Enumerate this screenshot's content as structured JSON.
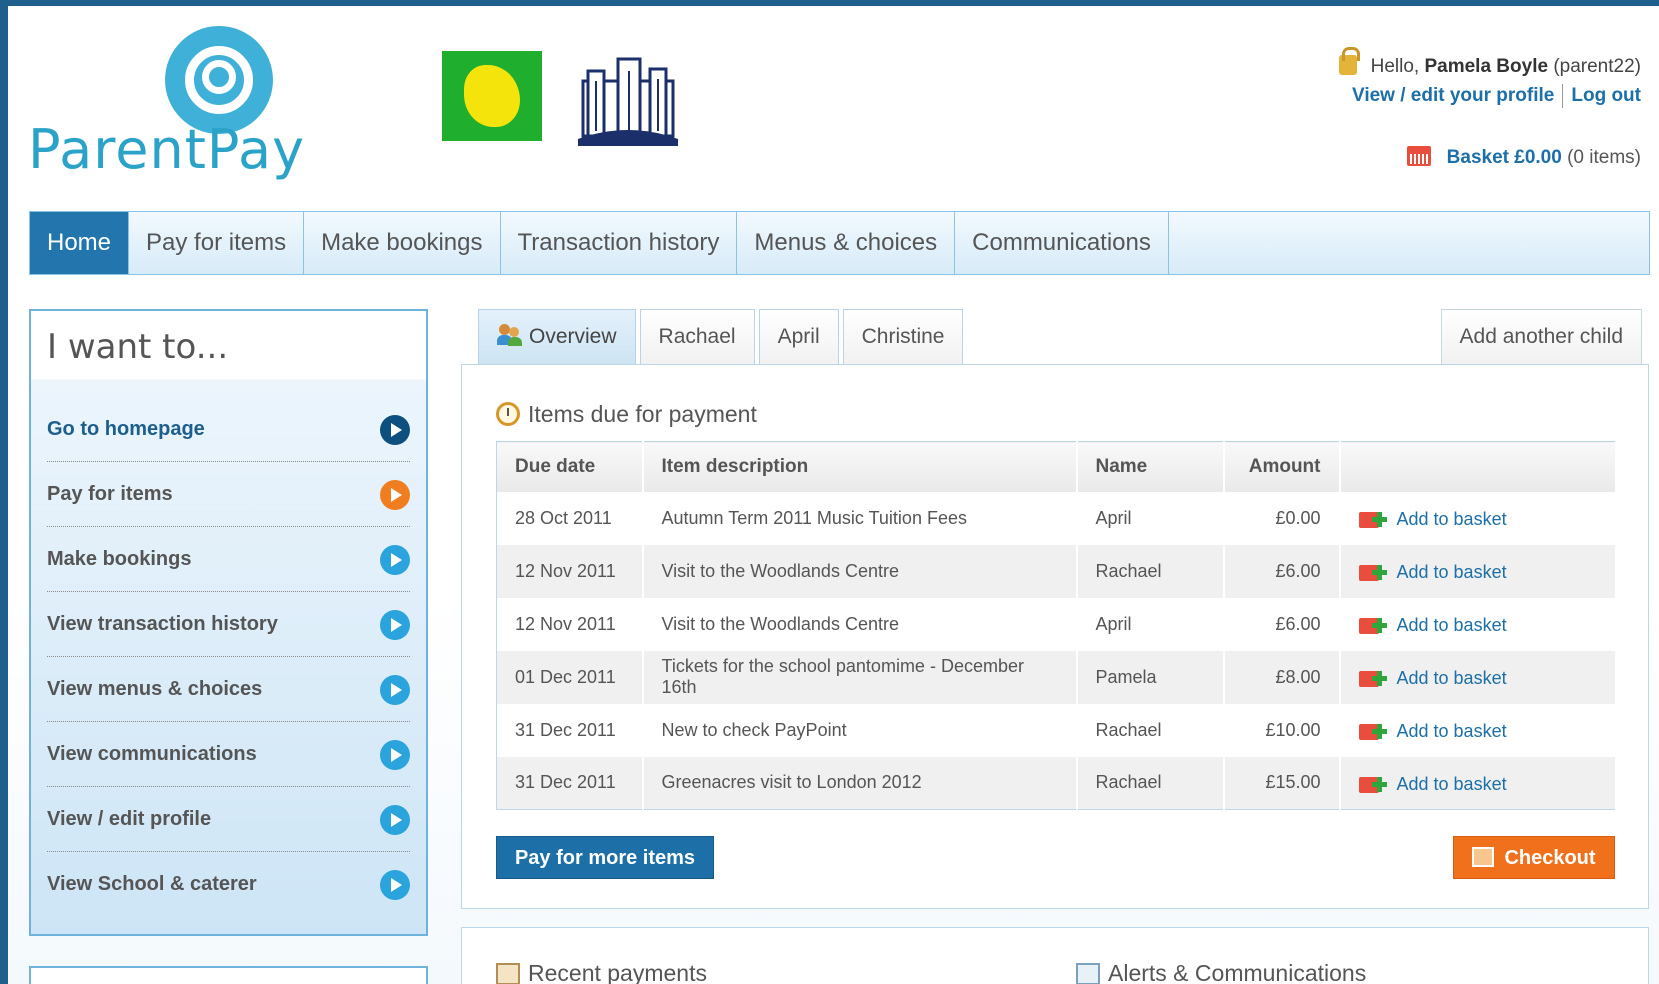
{
  "brand": {
    "name": "ParentPay"
  },
  "header": {
    "hello_prefix": "Hello,",
    "user_name": "Pamela Boyle",
    "user_id": "(parent22)",
    "profile_link": "View / edit your profile",
    "logout_link": "Log out",
    "basket_label": "Basket £0.00",
    "basket_count": "(0 items)"
  },
  "nav": {
    "items": [
      {
        "label": "Home",
        "active": true
      },
      {
        "label": "Pay for items"
      },
      {
        "label": "Make bookings"
      },
      {
        "label": "Transaction history"
      },
      {
        "label": "Menus & choices"
      },
      {
        "label": "Communications"
      }
    ]
  },
  "sidebar": {
    "title": "I want to...",
    "items": [
      {
        "label": "Go to homepage"
      },
      {
        "label": "Pay for items"
      },
      {
        "label": "Make bookings"
      },
      {
        "label": "View transaction history"
      },
      {
        "label": "View menus & choices"
      },
      {
        "label": "View communications"
      },
      {
        "label": "View / edit profile"
      },
      {
        "label": "View School & caterer"
      }
    ]
  },
  "tabs": {
    "items": [
      {
        "label": "Overview",
        "active": true,
        "icon": "people-icon"
      },
      {
        "label": "Rachael"
      },
      {
        "label": "April"
      },
      {
        "label": "Christine"
      }
    ],
    "add_child": "Add another child"
  },
  "items_due": {
    "title": "Items due for payment",
    "columns": [
      "Due date",
      "Item description",
      "Name",
      "Amount",
      ""
    ],
    "rows": [
      {
        "date": "28 Oct 2011",
        "description": "Autumn Term 2011 Music Tuition Fees",
        "name": "April",
        "amount": "£0.00",
        "action": "Add to basket"
      },
      {
        "date": "12 Nov 2011",
        "description": "Visit to the Woodlands Centre",
        "name": "Rachael",
        "amount": "£6.00",
        "action": "Add to basket"
      },
      {
        "date": "12 Nov 2011",
        "description": "Visit to the Woodlands Centre",
        "name": "April",
        "amount": "£6.00",
        "action": "Add to basket"
      },
      {
        "date": "01 Dec 2011",
        "description": "Tickets for the school pantomime - December 16th",
        "name": "Pamela",
        "amount": "£8.00",
        "action": "Add to basket"
      },
      {
        "date": "31 Dec 2011",
        "description": "New to check PayPoint",
        "name": "Rachael",
        "amount": "£10.00",
        "action": "Add to basket"
      },
      {
        "date": "31 Dec 2011",
        "description": "Greenacres visit to London 2012",
        "name": "Rachael",
        "amount": "£15.00",
        "action": "Add to basket"
      }
    ],
    "pay_more": "Pay for more items",
    "checkout": "Checkout"
  },
  "bottom": {
    "recent_payments": "Recent payments",
    "alerts": "Alerts & Communications"
  },
  "colors": {
    "nav_active": "#2276ad",
    "link": "#1c6fa7",
    "checkout": "#f0701c",
    "pay_more": "#1c6fa7"
  }
}
